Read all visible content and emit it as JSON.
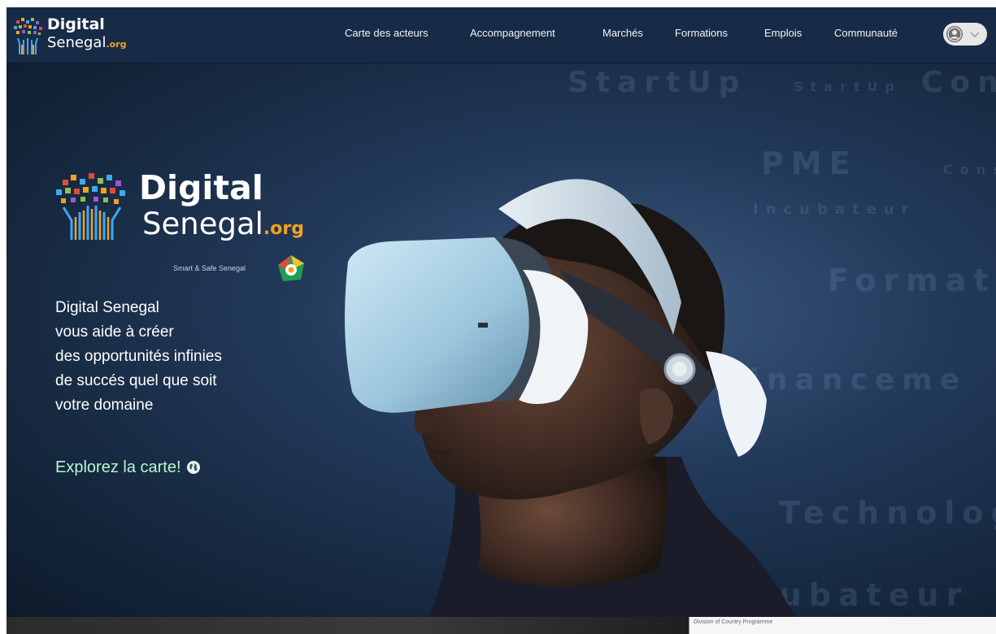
{
  "nav": {
    "logo": {
      "line1": "Digital",
      "line2": "Senegal",
      "suffix": ".org"
    },
    "links": [
      "Carte des acteurs",
      "Accompagnement",
      "Marchés",
      "Formations",
      "Emplois",
      "Communauté"
    ],
    "user_icon": "user-avatar-icon",
    "dropdown_icon": "chevron-down-icon"
  },
  "hero": {
    "background_words": [
      "StartUp",
      "StartUp",
      "Con",
      "PME",
      "Cons",
      "Incubateur",
      "Formati",
      "Financeme",
      "Technolog",
      "Incubateur"
    ],
    "brand": {
      "line1": "Digital",
      "line2": "Senegal",
      "suffix": ".org",
      "tagline": "Smart & Safe Senegal"
    },
    "text_lines": [
      "Digital Senegal",
      "vous aide à créer",
      "des opportunités infinies",
      "de succés quel que soit",
      "votre domaine"
    ],
    "cta": "Explorez la carte!",
    "cta_icon": "globe-icon"
  },
  "footer": {
    "snippet": "Division of Country Programme"
  },
  "colors": {
    "nav_bg": "#172b46",
    "accent_orange": "#f2a21f",
    "cta_green": "#b7f7d0"
  }
}
